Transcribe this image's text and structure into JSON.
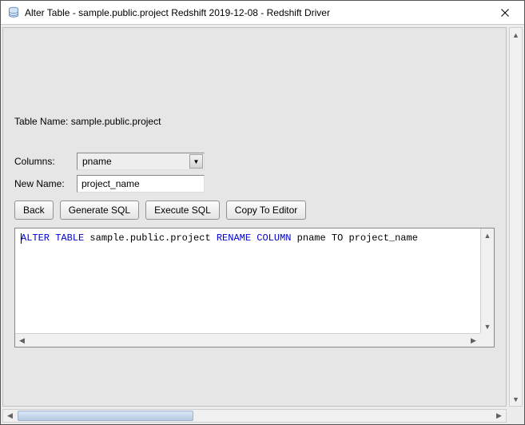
{
  "window": {
    "title": "Alter Table - sample.public.project Redshift 2019-12-08 - Redshift Driver"
  },
  "labels": {
    "table_name_prefix": "Table Name: ",
    "table_name_value": "sample.public.project",
    "columns": "Columns:",
    "new_name": "New Name:"
  },
  "form": {
    "selected_column": "pname",
    "new_name_value": "project_name"
  },
  "buttons": {
    "back": "Back",
    "generate_sql": "Generate SQL",
    "execute_sql": "Execute SQL",
    "copy_to_editor": "Copy To Editor"
  },
  "sql": {
    "kw_alter_table": "ALTER TABLE",
    "obj": " sample.public.project ",
    "kw_rename_column": "RENAME COLUMN",
    "tail": " pname TO project_name"
  }
}
